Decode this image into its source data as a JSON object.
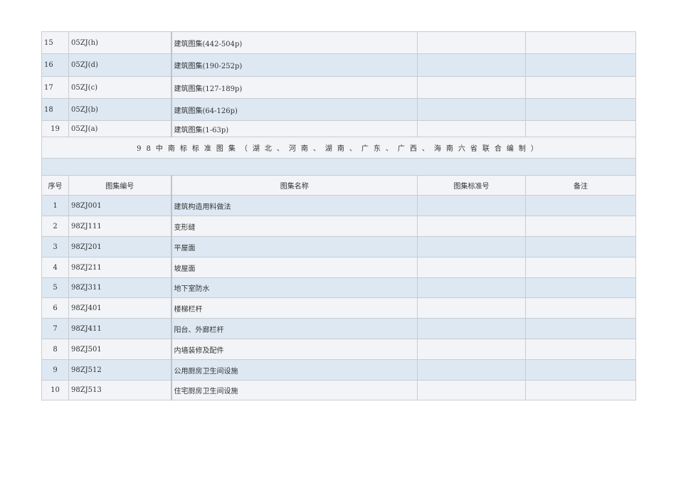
{
  "top_rows": [
    {
      "no": "15",
      "code": "05ZJ(h)",
      "name": "建筑图集(442-504p)",
      "std": "",
      "note": ""
    },
    {
      "no": "16",
      "code": "05ZJ(d)",
      "name": "建筑图集(190-252p)",
      "std": "",
      "note": ""
    },
    {
      "no": "17",
      "code": "05ZJ(c)",
      "name": "建筑图集(127-189p)",
      "std": "",
      "note": ""
    },
    {
      "no": "18",
      "code": "05ZJ(b)",
      "name": "建筑图集(64-126p)",
      "std": "",
      "note": ""
    },
    {
      "no": "19",
      "code": "05ZJ(a)",
      "name": "建筑图集(1-63p)",
      "std": "",
      "note": ""
    }
  ],
  "section_title": "98中南标标准图集（湖北、河南、湖南、广东、广西、海南六省联合编制）",
  "headers": {
    "no": "序号",
    "code": "图集编号",
    "name": "图集名称",
    "std": "图集标准号",
    "note": "备注"
  },
  "rows": [
    {
      "no": "1",
      "code": "98ZJ001",
      "name": "建筑构造用料做法"
    },
    {
      "no": "2",
      "code": "98ZJ111",
      "name": "变形缝"
    },
    {
      "no": "3",
      "code": "98ZJ201",
      "name": "平屋面"
    },
    {
      "no": "4",
      "code": "98ZJ211",
      "name": "坡屋面"
    },
    {
      "no": "5",
      "code": "98ZJ311",
      "name": "地下室防水"
    },
    {
      "no": "6",
      "code": "98ZJ401",
      "name": "楼梯栏杆"
    },
    {
      "no": "7",
      "code": "98ZJ411",
      "name": "阳台、外廊栏杆"
    },
    {
      "no": "8",
      "code": "98ZJ501",
      "name": "内墙装修及配件"
    },
    {
      "no": "9",
      "code": "98ZJ512",
      "name": "公用厨房卫生间设施"
    },
    {
      "no": "10",
      "code": "98ZJ513",
      "name": "住宅厨房卫生间设施"
    }
  ]
}
